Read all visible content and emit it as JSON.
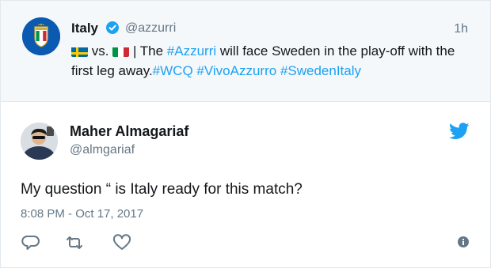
{
  "parent_tweet": {
    "name": "Italy",
    "handle": "@azzurri",
    "time": "1h",
    "text_vs": "vs.",
    "text_a": "| The ",
    "hashtag_azzurri": "#Azzurri",
    "text_b": " will face Sweden in the play-off with the first leg away.",
    "hashtag_wcq": "#WCQ",
    "hashtag_vivo": "#VivoAzzurro",
    "hashtag_swedenitaly": "#SwedenItaly"
  },
  "reply": {
    "name": "Maher Almagariaf",
    "handle": "@almgariaf",
    "text": "My question “ is Italy ready for this match?",
    "timestamp": "8:08 PM - Oct 17, 2017"
  },
  "colors": {
    "link": "#1da1f2",
    "muted": "#657786",
    "text": "#14171a",
    "parent_bg": "#f5f8fa"
  },
  "icons": [
    "verified-badge-icon",
    "sweden-flag-icon",
    "italy-flag-icon",
    "twitter-bird-icon",
    "reply-icon",
    "retweet-icon",
    "like-icon",
    "info-icon"
  ]
}
